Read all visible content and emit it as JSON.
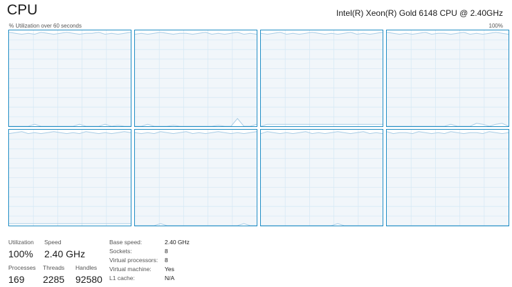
{
  "header": {
    "title": "CPU",
    "cpu_name": "Intel(R) Xeon(R) Gold 6148 CPU @ 2.40GHz",
    "graph_label": "% Utilization over 60 seconds",
    "graph_max_label": "100%"
  },
  "colors": {
    "graph_border": "#1e8cc4",
    "grid_line": "#d7e9f5",
    "usage_fill": "#f1f6fa",
    "usage_line": "#a9cde6"
  },
  "graphs": [
    {
      "name": "core-0",
      "usage_top": [
        98,
        97,
        96,
        97,
        96,
        98,
        97,
        96,
        97,
        98,
        97,
        96,
        97,
        97,
        98,
        96,
        97,
        96,
        97,
        98
      ],
      "usage_bottom": [
        0,
        0,
        0,
        0,
        2,
        0,
        0,
        0,
        0,
        0,
        0,
        2,
        0,
        0,
        0,
        2,
        0,
        1,
        0,
        0
      ]
    },
    {
      "name": "core-1",
      "usage_top": [
        96,
        97,
        96,
        97,
        98,
        97,
        96,
        97,
        97,
        96,
        97,
        98,
        96,
        97,
        96,
        97,
        98,
        96,
        97,
        96
      ],
      "usage_bottom": [
        0,
        0,
        2,
        0,
        0,
        0,
        1,
        0,
        0,
        0,
        0,
        0,
        0,
        1,
        0,
        0,
        8,
        0,
        0,
        2
      ]
    },
    {
      "name": "core-2",
      "usage_top": [
        97,
        96,
        97,
        98,
        96,
        97,
        96,
        97,
        98,
        97,
        96,
        97,
        96,
        97,
        98,
        96,
        97,
        96,
        97,
        98
      ],
      "usage_bottom": [
        0,
        2,
        2,
        2,
        2,
        2,
        2,
        2,
        2,
        2,
        2,
        2,
        2,
        2,
        2,
        2,
        2,
        2,
        2,
        2
      ]
    },
    {
      "name": "core-3",
      "usage_top": [
        98,
        97,
        96,
        97,
        96,
        97,
        98,
        96,
        97,
        97,
        96,
        97,
        98,
        96,
        97,
        96,
        97,
        98,
        97,
        96
      ],
      "usage_bottom": [
        0,
        0,
        0,
        0,
        0,
        0,
        0,
        0,
        0,
        0,
        2,
        0,
        0,
        0,
        3,
        2,
        0,
        2,
        3,
        0
      ]
    },
    {
      "name": "core-4",
      "usage_top": [
        96,
        97,
        98,
        96,
        97,
        96,
        97,
        98,
        97,
        96,
        97,
        96,
        98,
        97,
        96,
        97,
        96,
        97,
        98,
        97
      ],
      "usage_bottom": [
        2,
        2,
        2,
        2,
        2,
        2,
        2,
        2,
        2,
        2,
        2,
        2,
        2,
        2,
        2,
        2,
        2,
        2,
        2,
        2
      ]
    },
    {
      "name": "core-5",
      "usage_top": [
        97,
        96,
        97,
        96,
        98,
        97,
        96,
        97,
        98,
        96,
        97,
        96,
        97,
        98,
        97,
        96,
        97,
        96,
        97,
        98
      ],
      "usage_bottom": [
        0,
        0,
        0,
        0,
        2,
        0,
        0,
        0,
        0,
        0,
        0,
        0,
        0,
        0,
        0,
        0,
        0,
        2,
        0,
        0
      ]
    },
    {
      "name": "core-6",
      "usage_top": [
        96,
        98,
        97,
        96,
        97,
        96,
        97,
        98,
        96,
        97,
        96,
        97,
        98,
        97,
        96,
        97,
        98,
        96,
        97,
        96
      ],
      "usage_bottom": [
        0,
        0,
        0,
        0,
        0,
        0,
        0,
        0,
        0,
        0,
        0,
        0,
        2,
        0,
        0,
        0,
        0,
        0,
        0,
        0
      ]
    },
    {
      "name": "core-7",
      "usage_top": [
        98,
        96,
        97,
        97,
        96,
        98,
        97,
        96,
        97,
        96,
        98,
        97,
        96,
        97,
        97,
        96,
        98,
        97,
        96,
        97
      ],
      "usage_bottom": [
        0,
        0,
        0,
        0,
        0,
        0,
        0,
        0,
        0,
        0,
        0,
        0,
        0,
        0,
        0,
        0,
        0,
        0,
        0,
        0
      ]
    }
  ],
  "stats": {
    "utilization_label": "Utilization",
    "utilization_value": "100%",
    "speed_label": "Speed",
    "speed_value": "2.40 GHz",
    "processes_label": "Processes",
    "processes_value": "169",
    "threads_label": "Threads",
    "threads_value": "2285",
    "handles_label": "Handles",
    "handles_value": "92580"
  },
  "details": [
    {
      "key": "Base speed:",
      "value": "2.40 GHz"
    },
    {
      "key": "Sockets:",
      "value": "8"
    },
    {
      "key": "Virtual processors:",
      "value": "8"
    },
    {
      "key": "Virtual machine:",
      "value": "Yes"
    },
    {
      "key": "L1 cache:",
      "value": "N/A"
    }
  ]
}
